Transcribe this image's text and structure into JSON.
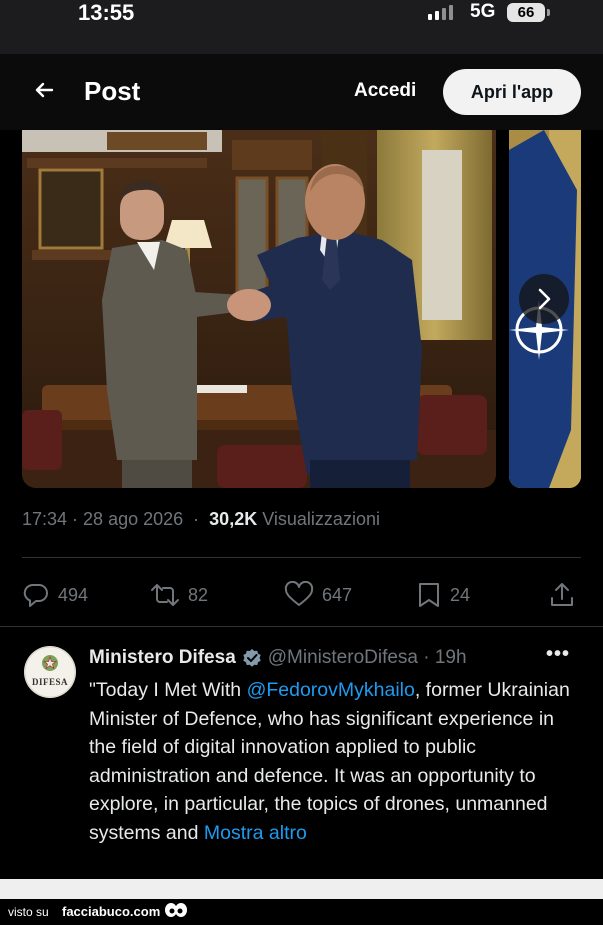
{
  "status_bar": {
    "time": "13:55",
    "network": "5G",
    "battery": "66"
  },
  "header": {
    "title": "Post",
    "login_label": "Accedi",
    "open_app_label": "Apri l'app"
  },
  "post": {
    "timestamp": "17:34 · 28 ago 2026",
    "views_count": "30,2K",
    "views_label": "Visualizzazioni",
    "replies": "494",
    "reposts": "82",
    "likes": "647",
    "bookmarks": "24"
  },
  "quoted": {
    "avatar_text": "DIFESA",
    "name": "Ministero Difesa",
    "handle": "@MinisteroDifesa · 19h",
    "text_1": "\"Today I Met With ",
    "mention": "@FedorovMykhailo",
    "text_2": ", former Ukrainian Minister of Defence, who has significant experience in the field of digital innovation applied to public administration and defence. It was an opportunity to explore, in particular, the topics of drones, unmanned systems and ",
    "show_more": "Mostra altro"
  },
  "footer": {
    "visto_su": "visto su",
    "site": "facciabuco.com"
  },
  "colors": {
    "link": "#1d9bf0",
    "muted": "#71767b",
    "verified": "#829aab"
  }
}
